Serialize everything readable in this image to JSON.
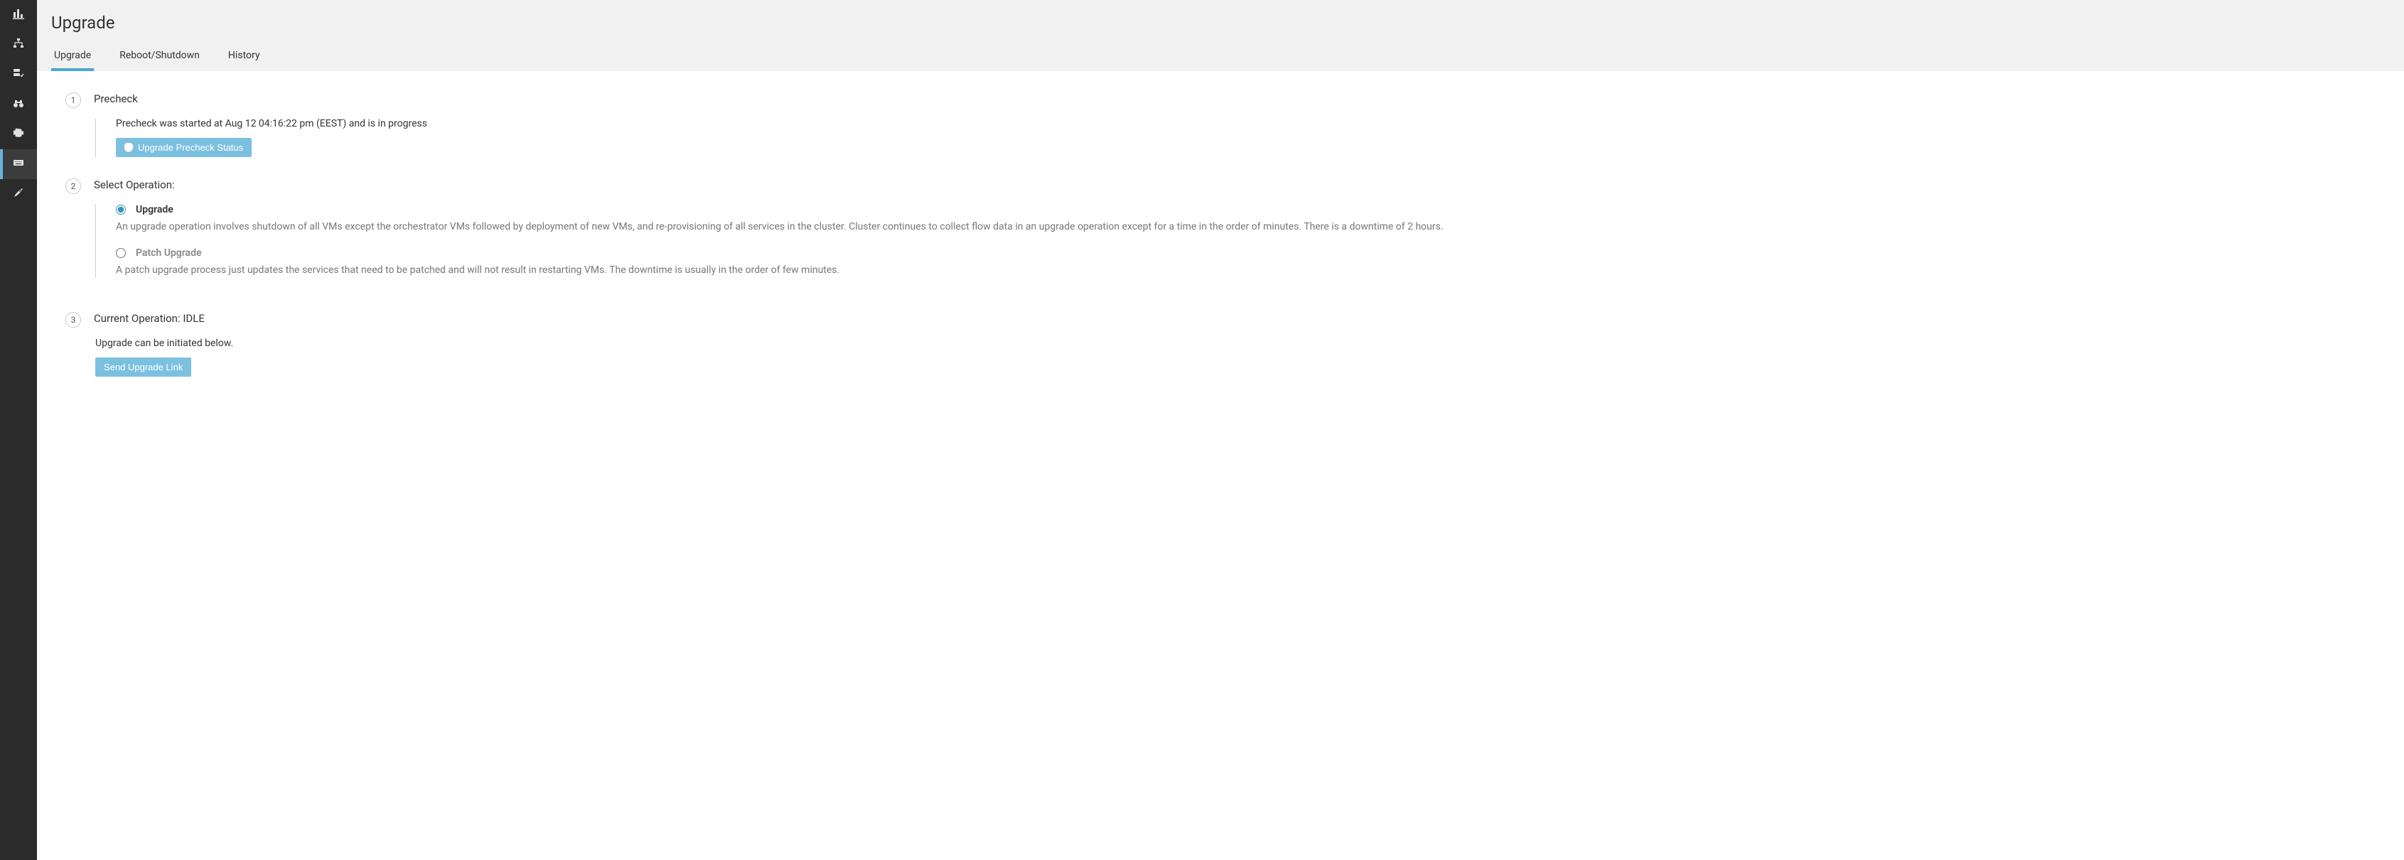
{
  "sidebar": {
    "items": [
      {
        "id": "dashboard",
        "icon": "bar-chart-icon"
      },
      {
        "id": "topology",
        "icon": "sitemap-icon"
      },
      {
        "id": "inventory",
        "icon": "server-check-icon"
      },
      {
        "id": "observe",
        "icon": "binoculars-icon"
      },
      {
        "id": "settings",
        "icon": "gear-icon"
      },
      {
        "id": "upgrade",
        "icon": "keyboard-icon",
        "active": true
      },
      {
        "id": "tools",
        "icon": "tools-icon"
      }
    ]
  },
  "header": {
    "title": "Upgrade",
    "tabs": [
      {
        "id": "upgrade",
        "label": "Upgrade",
        "active": true
      },
      {
        "id": "reboot",
        "label": "Reboot/Shutdown"
      },
      {
        "id": "history",
        "label": "History"
      }
    ]
  },
  "steps": {
    "precheck": {
      "num": "1",
      "title": "Precheck",
      "status_line": "Precheck was started at Aug 12 04:16:22 pm (EEST) and is in progress",
      "btn_label": "Upgrade Precheck Status"
    },
    "select": {
      "num": "2",
      "title": "Select Operation:",
      "options": [
        {
          "id": "upgrade",
          "label": "Upgrade",
          "selected": true,
          "desc": "An upgrade operation involves shutdown of all VMs except the orchestrator VMs followed by deployment of new VMs, and re-provisioning of all services in the cluster. Cluster continues to collect flow data in an upgrade operation except for a time in the order of minutes. There is a downtime of 2 hours."
        },
        {
          "id": "patch",
          "label": "Patch Upgrade",
          "selected": false,
          "desc": "A patch upgrade process just updates the services that need to be patched and will not result in restarting VMs. The downtime is usually in the order of few minutes."
        }
      ]
    },
    "current": {
      "num": "3",
      "title": "Current Operation: IDLE",
      "msg": "Upgrade can be initiated below.",
      "btn_label": "Send Upgrade Link"
    }
  },
  "colors": {
    "accent": "#7cc0e0",
    "tab_active": "#4aa7d0"
  }
}
